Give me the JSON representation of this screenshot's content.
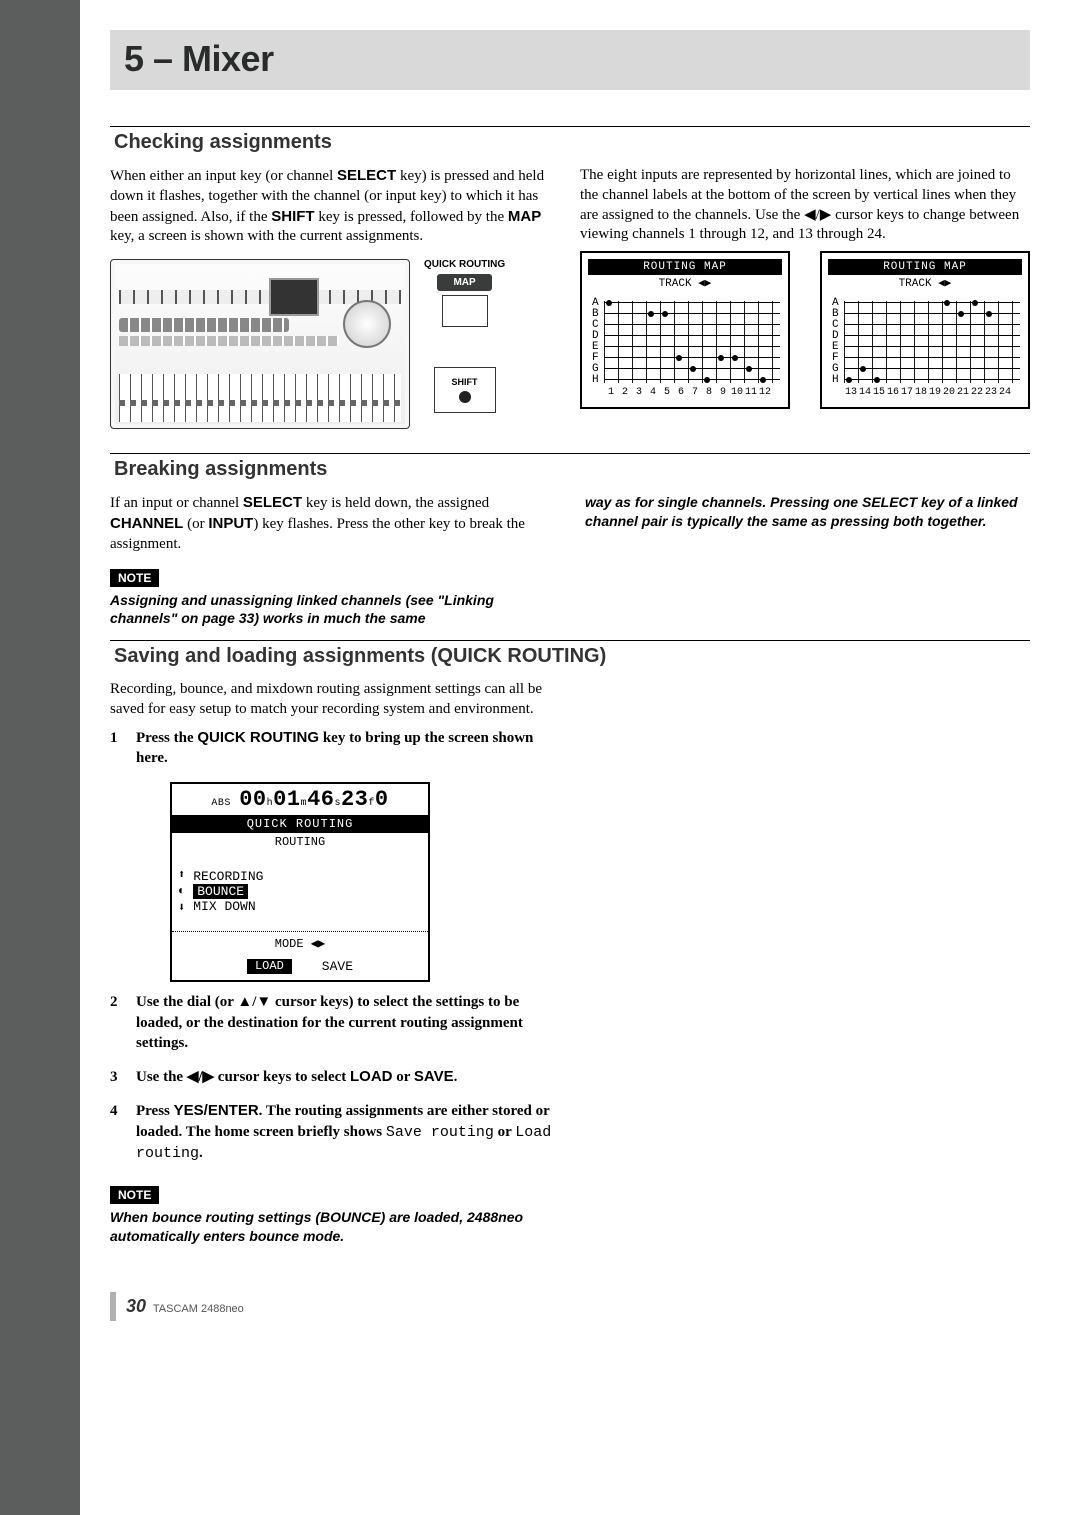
{
  "chapter": "5 – Mixer",
  "sections": {
    "checking": {
      "title": "Checking assignments",
      "left_p1_a": "When either an input key (or channel ",
      "left_p1_key1": "SELECT",
      "left_p1_b": " key) is pressed and held down it flashes, together with the channel (or input key) to which it has been assigned. Also, if the ",
      "left_p1_key2": "SHIFT",
      "left_p1_c": " key is pressed, followed by the ",
      "left_p1_key3": "MAP",
      "left_p1_d": " key, a screen is shown with the current assignments.",
      "right_p1_a": "The eight inputs are represented by horizontal lines, which are joined to the channel labels at the bottom of the screen by vertical lines when they are assigned to the channels. Use the ",
      "right_p1_b": " cursor keys to change between viewing channels 1 through 12, and 13 through 24.",
      "callout_quick": "QUICK ROUTING",
      "callout_map": "MAP",
      "callout_shift": "SHIFT"
    },
    "routing_map": {
      "title": "ROUTING MAP",
      "sub": "TRACK ◀▶",
      "row_labels": [
        "A",
        "B",
        "C",
        "D",
        "E",
        "F",
        "G",
        "H"
      ],
      "x1": [
        "1",
        "2",
        "3",
        "4",
        "5",
        "6",
        "7",
        "8",
        "9",
        "10",
        "11",
        "12"
      ],
      "x2": [
        "13",
        "14",
        "15",
        "16",
        "17",
        "18",
        "19",
        "20",
        "21",
        "22",
        "23",
        "24"
      ]
    },
    "breaking": {
      "title": "Breaking assignments",
      "left_a": "If an input or channel ",
      "left_key1": "SELECT",
      "left_b": " key is held down, the assigned ",
      "left_key2": "CHANNEL",
      "left_c": " (or ",
      "left_key3": "INPUT",
      "left_d": ") key flashes. Press the other key to break the assignment.",
      "note_label": "NOTE",
      "note_text": "Assigning and unassigning linked channels (see \"Linking channels\" on page 33) works in much the same",
      "right_note": "way as for single channels. Pressing one SELECT key of a linked channel pair is typically the same as pressing both together."
    },
    "saving": {
      "title": "Saving and loading assignments (QUICK ROUTING)",
      "intro": "Recording, bounce, and mixdown routing assignment settings can all be saved for easy setup to match your recording system and environment.",
      "step1_a": "Press the ",
      "step1_key": "QUICK ROUTING",
      "step1_b": " key to bring up the screen shown here.",
      "step2": "Use the dial (or ▲/▼ cursor keys) to select the settings to be loaded, or the destination for the current routing assignment settings.",
      "step3_a": "Use the ◀/▶ cursor keys to select ",
      "step3_k1": "LOAD",
      "step3_b": " or ",
      "step3_k2": "SAVE",
      "step3_c": ".",
      "step4_a": "Press ",
      "step4_k1": "YES/ENTER",
      "step4_b": ". The routing assignments are either stored or loaded. The home screen briefly shows ",
      "step4_m1": "Save routing",
      "step4_c": " or ",
      "step4_m2": "Load routing",
      "step4_d": ".",
      "note_label": "NOTE",
      "note_text": "When bounce routing settings (BOUNCE) are loaded, 2488neo automatically enters bounce mode."
    },
    "qr_lcd": {
      "abs": "ABS",
      "h": "00",
      "hl": "h",
      "m": "01",
      "ml": "m",
      "s": "46",
      "sl": "s",
      "f": "23",
      "fl": "f",
      "sub": "0",
      "bar": "QUICK ROUTING",
      "sub2": "ROUTING",
      "opt1": "RECORDING",
      "opt2": "BOUNCE",
      "opt3": "MIX DOWN",
      "mode": "MODE ◀▶",
      "load": "LOAD",
      "save": "SAVE"
    }
  },
  "footer": {
    "page": "30",
    "product": "TASCAM  2488neo"
  },
  "chart_data": [
    {
      "type": "scatter",
      "title": "ROUTING MAP (tracks 1-12)",
      "y_categories": [
        "A",
        "B",
        "C",
        "D",
        "E",
        "F",
        "G",
        "H"
      ],
      "x": [
        1,
        2,
        3,
        4,
        5,
        6,
        7,
        8,
        9,
        10,
        11,
        12
      ],
      "points": [
        {
          "y": "A",
          "x": 1
        },
        {
          "y": "B",
          "x": 4
        },
        {
          "y": "B",
          "x": 5
        },
        {
          "y": "F",
          "x": 6
        },
        {
          "y": "F",
          "x": 9
        },
        {
          "y": "F",
          "x": 10
        },
        {
          "y": "G",
          "x": 7
        },
        {
          "y": "G",
          "x": 11
        },
        {
          "y": "H",
          "x": 8
        },
        {
          "y": "H",
          "x": 12
        }
      ]
    },
    {
      "type": "scatter",
      "title": "ROUTING MAP (tracks 13-24)",
      "y_categories": [
        "A",
        "B",
        "C",
        "D",
        "E",
        "F",
        "G",
        "H"
      ],
      "x": [
        13,
        14,
        15,
        16,
        17,
        18,
        19,
        20,
        21,
        22,
        23,
        24
      ],
      "points": [
        {
          "y": "A",
          "x": 20
        },
        {
          "y": "A",
          "x": 22
        },
        {
          "y": "B",
          "x": 21
        },
        {
          "y": "B",
          "x": 23
        },
        {
          "y": "G",
          "x": 14
        },
        {
          "y": "H",
          "x": 13
        },
        {
          "y": "H",
          "x": 15
        }
      ]
    }
  ]
}
